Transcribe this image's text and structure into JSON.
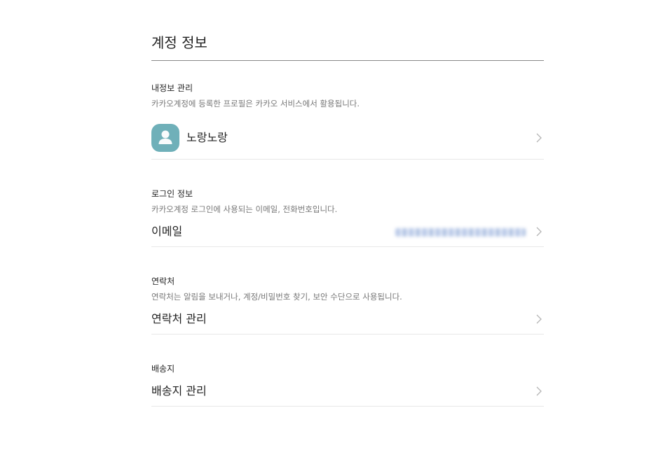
{
  "page": {
    "title": "계정 정보"
  },
  "profile_section": {
    "heading": "내정보 관리",
    "description": "카카오계정에 등록한 프로필은 카카오 서비스에서 활용됩니다.",
    "nickname": "노랑노랑",
    "avatar_color": "#6fb0b9"
  },
  "login_section": {
    "heading": "로그인 정보",
    "description": "카카오계정 로그인에 사용되는 이메일, 전화번호입니다.",
    "email_label": "이메일"
  },
  "contact_section": {
    "heading": "연락처",
    "description": "연락처는 알림을 보내거나, 계정/비밀번호 찾기, 보안 수단으로 사용됩니다.",
    "manage_label": "연락처 관리"
  },
  "shipping_section": {
    "heading": "배송지",
    "manage_label": "배송지 관리"
  },
  "icons": {
    "avatar": "person-icon",
    "chevron": "chevron-right-icon"
  }
}
